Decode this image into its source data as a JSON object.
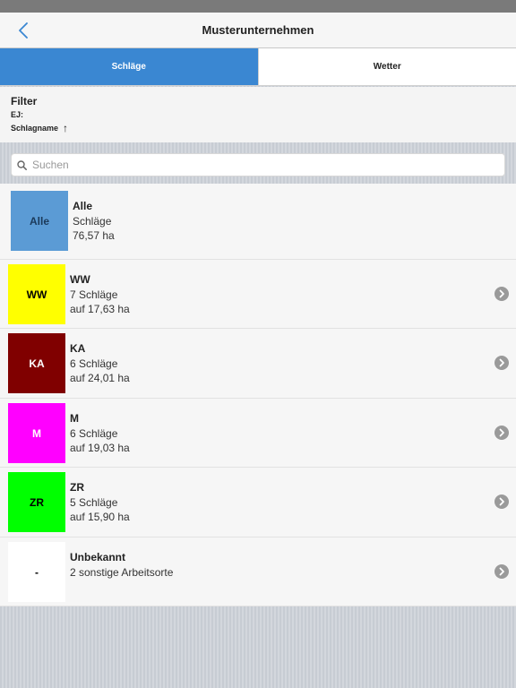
{
  "nav": {
    "title": "Musterunternehmen"
  },
  "tabs": [
    {
      "label": "Schläge",
      "active": true
    },
    {
      "label": "Wetter",
      "active": false
    }
  ],
  "filter": {
    "title": "Filter",
    "ej_label": "EJ:",
    "sort_label": "Schlagname",
    "sort_arrow": "↑"
  },
  "search": {
    "placeholder": "Suchen",
    "value": ""
  },
  "list": [
    {
      "code": "Alle",
      "title": "Alle",
      "line1": "Schläge",
      "line2": "76,57 ha",
      "color": "#5b9bd5",
      "text_color": "#1b3a5a",
      "has_chevron": false
    },
    {
      "code": "WW",
      "title": "WW",
      "line1": "7 Schläge",
      "line2": "auf 17,63 ha",
      "color": "#ffff00",
      "text_color": "#000000",
      "has_chevron": true
    },
    {
      "code": "KA",
      "title": "KA",
      "line1": "6 Schläge",
      "line2": "auf 24,01 ha",
      "color": "#800000",
      "text_color": "#ffffff",
      "has_chevron": true
    },
    {
      "code": "M",
      "title": "M",
      "line1": "6 Schläge",
      "line2": "auf 19,03 ha",
      "color": "#ff00ff",
      "text_color": "#ffffff",
      "has_chevron": true
    },
    {
      "code": "ZR",
      "title": "ZR",
      "line1": "5 Schläge",
      "line2": "auf 15,90 ha",
      "color": "#00ff00",
      "text_color": "#000000",
      "has_chevron": true
    },
    {
      "code": "-",
      "title": "Unbekannt",
      "line1": "2 sonstige Arbeitsorte",
      "line2": "",
      "color": "#ffffff",
      "text_color": "#000000",
      "has_chevron": true
    }
  ]
}
